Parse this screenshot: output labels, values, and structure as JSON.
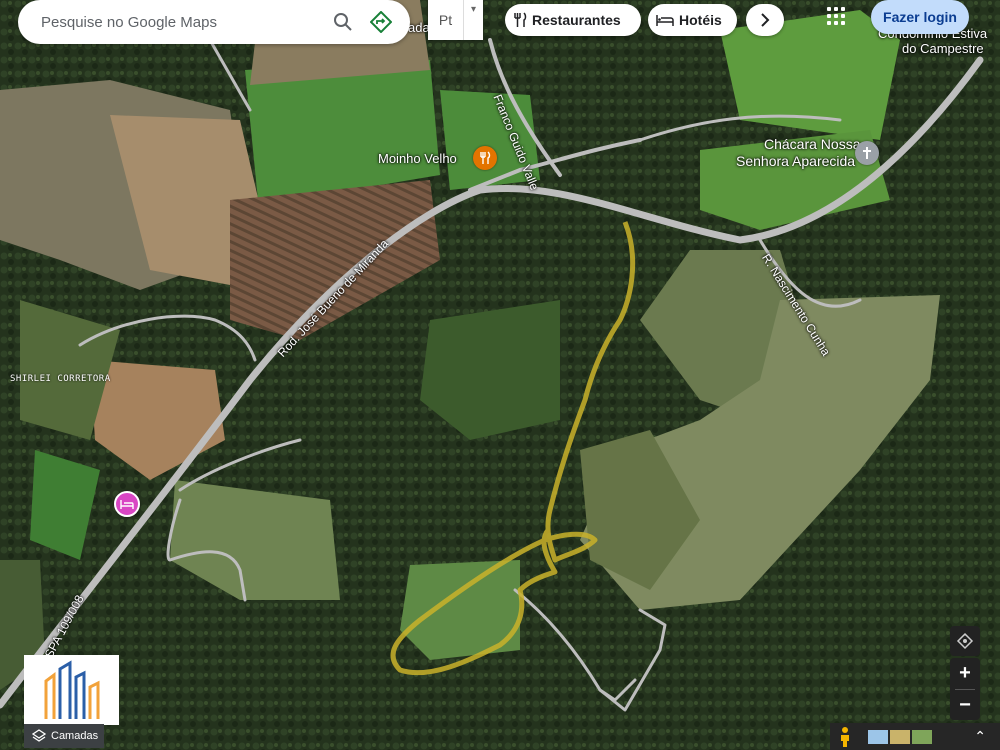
{
  "search": {
    "placeholder": "Pesquise no Google Maps"
  },
  "language": {
    "code": "Pt",
    "caret": "▾"
  },
  "chips": [
    {
      "label": "Restaurantes",
      "icon": "fork-knife-icon"
    },
    {
      "label": "Hotéis",
      "icon": "bed-icon"
    }
  ],
  "header": {
    "login_label": "Fazer login"
  },
  "places": {
    "moinho": "Moinho Velho",
    "chacara_line1": "Chácara Nossa",
    "chacara_line2": "Senhora Aparecida",
    "condominio_line1": "Condomínio Estiva",
    "condominio_line2": "do Campestre",
    "shirlei": "SHIRLEI CORRETORA",
    "partial": "ada"
  },
  "roads": {
    "rod": "Rod. José Bueno de Miranda",
    "franco": "Franco Guido Valle",
    "nascimento": "R. Nascimento Cunha",
    "spa": "SPA 109/008"
  },
  "controls": {
    "layers_label": "Camadas",
    "zoom_in": "+",
    "zoom_out": "−",
    "expand": "⌃"
  },
  "colors": {
    "boundary": "#c9b22a",
    "road": "#b9b9b9",
    "restaurant_pin": "#e37400",
    "hotel_pin": "#d946c4",
    "login_bg": "#c2dcfb"
  }
}
